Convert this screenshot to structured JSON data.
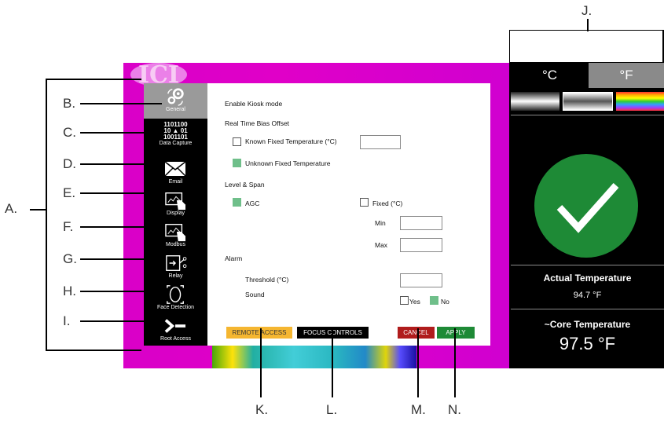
{
  "logo_text": "ICI",
  "sidebar": {
    "items": [
      {
        "label": "General",
        "icon": "gear-icon",
        "active": true
      },
      {
        "label": "Data Capture",
        "icon": "binary-person-icon",
        "binary_line1": "1101100",
        "binary_line2": "10",
        "binary_line2b": "01",
        "binary_line3": "1001101"
      },
      {
        "label": "Email",
        "icon": "envelope-icon"
      },
      {
        "label": "Display",
        "icon": "display-touch-icon"
      },
      {
        "label": "Modbus",
        "icon": "modbus-touch-icon"
      },
      {
        "label": "Relay",
        "icon": "relay-icon"
      },
      {
        "label": "Face Detection",
        "icon": "face-scan-icon"
      },
      {
        "label": "Root Access",
        "icon": "terminal-prompt-icon"
      }
    ]
  },
  "form": {
    "kiosk_label": "Enable Kiosk mode",
    "bias_heading": "Real Time Bias Offset",
    "known_fixed_label": "Known Fixed Temperature (°C)",
    "known_fixed_checked": false,
    "known_fixed_value": "",
    "unknown_fixed_label": "Unknown Fixed Temperature",
    "unknown_fixed_checked": true,
    "level_heading": "Level & Span",
    "agc_label": "AGC",
    "agc_checked": true,
    "fixed_label": "Fixed (°C)",
    "fixed_checked": false,
    "min_label": "Min",
    "min_value": "",
    "max_label": "Max",
    "max_value": "",
    "alarm_heading": "Alarm",
    "threshold_label": "Threshold (°C)",
    "threshold_value": "",
    "sound_label": "Sound",
    "yes_label": "Yes",
    "yes_checked": false,
    "no_label": "No",
    "no_checked": true
  },
  "buttons": {
    "remote_access": "REMOTE ACCESS",
    "focus_controls": "FOCUS CONTROLS",
    "cancel": "CANCEL",
    "apply": "APPLY"
  },
  "right_panel": {
    "unit_c": "°C",
    "unit_f": "°F",
    "selected_unit": "°C",
    "palettes": [
      "grayscale-dark",
      "grayscale-light",
      "rainbow"
    ],
    "status_icon": "checkmark-icon",
    "actual_label": "Actual Temperature",
    "actual_value": "94.7 °F",
    "core_label": "~Core Temperature",
    "core_value": "97.5 °F"
  },
  "annotations": {
    "A": "A.",
    "B": "B.",
    "C": "C.",
    "D": "D.",
    "E": "E.",
    "F": "F.",
    "G": "G.",
    "H": "H.",
    "I": "I.",
    "J": "J.",
    "K": "K.",
    "L": "L.",
    "M": "M.",
    "N": "N."
  },
  "colors": {
    "thermal_magenta": "#d900c8",
    "sidebar_bg": "#000000",
    "active_item": "#9a9a9a",
    "checkbox_on": "#6fbf8a",
    "remote_access": "#f5b630",
    "focus_controls": "#000000",
    "cancel": "#b01c1c",
    "apply": "#1e8a36",
    "check_circle": "#1e8a36"
  }
}
